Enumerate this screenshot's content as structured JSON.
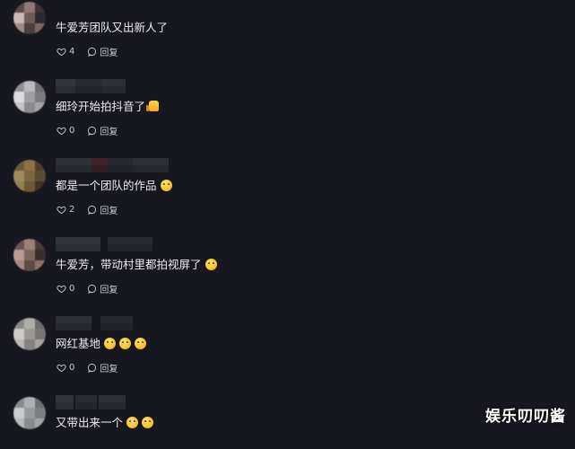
{
  "comments": [
    {
      "text": "牛爱芳团队又出新人了",
      "emoji": "",
      "likes": "4",
      "reply_label": "回复",
      "avatar_colors": [
        "#5b4a4a",
        "#8e7b78",
        "#3a3236",
        "#c9b9b4",
        "#6e5a58",
        "#2c2830",
        "#9d8a86",
        "#4b3f41",
        "#7a6765"
      ]
    },
    {
      "text": "细玲开始拍抖音了",
      "emoji": "thumbs-up",
      "likes": "0",
      "reply_label": "回复",
      "avatar_colors": [
        "#8f8f94",
        "#b9b9be",
        "#6d6d72",
        "#dcdcdf",
        "#9e9ea3",
        "#7b7b80",
        "#c4c4c8",
        "#8a8a8f",
        "#a5a5aa"
      ]
    },
    {
      "text": "都是一个团队的作品",
      "emoji": "smile",
      "likes": "2",
      "reply_label": "回复",
      "avatar_colors": [
        "#6b5a3c",
        "#8a7349",
        "#4f3f2a",
        "#a08a5c",
        "#7a6641",
        "#5a4a32",
        "#93804f",
        "#6a5838",
        "#3f3323"
      ]
    },
    {
      "text": "牛爱芳，带动村里都拍视屏了",
      "emoji": "smile",
      "likes": "0",
      "reply_label": "回复",
      "avatar_colors": [
        "#6a5552",
        "#9a8179",
        "#4a3b39",
        "#b89c92",
        "#7d6660",
        "#3a2f2e",
        "#a58b83",
        "#5e4c49",
        "#8b726b"
      ]
    },
    {
      "text": "网红基地",
      "emoji": "triple",
      "likes": "0",
      "reply_label": "回复",
      "avatar_colors": [
        "#8c8a87",
        "#b1aeaa",
        "#6f6d6a",
        "#cfccc8",
        "#9b9894",
        "#797673",
        "#bdbab6",
        "#858280",
        "#a6a39f"
      ]
    },
    {
      "text": "又带出来一个",
      "emoji": "double",
      "likes": "",
      "reply_label": "",
      "avatar_colors": [
        "#8a8d8f",
        "#aeb1b3",
        "#6e7173",
        "#c9ccce",
        "#999c9e",
        "#7c7f81",
        "#b7babb",
        "#888b8d",
        "#a2a5a7"
      ]
    }
  ],
  "watermark": "娱乐叨叨酱",
  "colors": {
    "background": "#171720",
    "text": "#ececf0",
    "meta": "#c9c9d0"
  }
}
